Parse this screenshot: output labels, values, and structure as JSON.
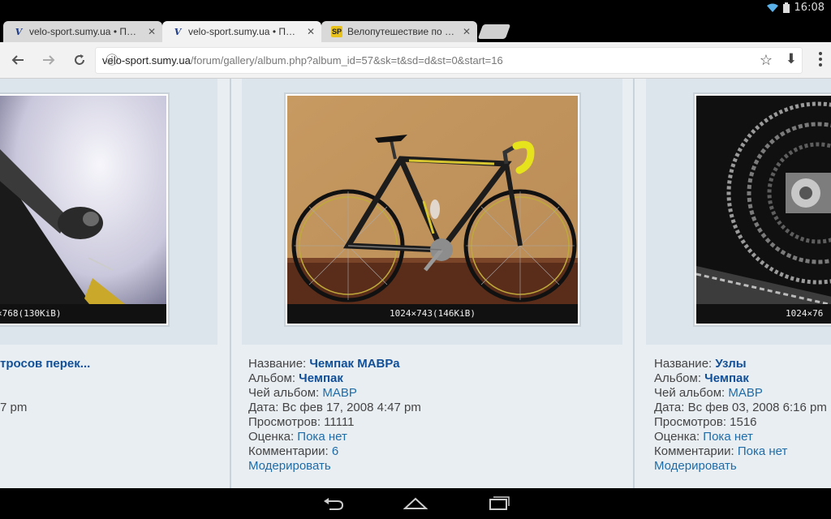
{
  "status_bar": {
    "time": "16:08",
    "icons": [
      "wifi-icon",
      "battery-icon"
    ]
  },
  "tabs": [
    {
      "favicon": "V",
      "title": "velo-sport.sumy.ua • Просмо",
      "active": false
    },
    {
      "favicon": "V",
      "title": "velo-sport.sumy.ua • Просмо",
      "active": true
    },
    {
      "favicon": "SP",
      "title": "Велопутешествие по Одесс",
      "active": false
    }
  ],
  "toolbar": {
    "url_host": "velo-sport.sumy.ua",
    "url_path": "/forum/gallery/album.php?album_id=57&sk=t&sd=d&st=0&start=16"
  },
  "gallery": {
    "items": [
      {
        "caption": "×768(130KiB)",
        "name_label": "",
        "name": "тросов перек...",
        "date_tail": "7 pm"
      },
      {
        "caption": "1024×743(146KiB)",
        "name_label": "Название:",
        "name": "Чемпак МАВРа",
        "album_label": "Альбом:",
        "album": "Чемпак",
        "owner_label": "Чей альбом:",
        "owner": "МАВР",
        "date_label": "Дата:",
        "date": "Вс фев 17, 2008 4:47 pm",
        "views_label": "Просмотров:",
        "views": "11111",
        "rating_label": "Оценка:",
        "rating": "Пока нет",
        "comments_label": "Комментарии:",
        "comments": "6",
        "moderate": "Модерировать"
      },
      {
        "caption": "1024×76",
        "name_label": "Название:",
        "name": "Узлы",
        "album_label": "Альбом:",
        "album": "Чемпак",
        "owner_label": "Чей альбом:",
        "owner": "МАВР",
        "date_label": "Дата:",
        "date": "Вс фев 03, 2008 6:16 pm",
        "views_label": "Просмотров:",
        "views": "1516",
        "rating_label": "Оценка:",
        "rating": "Пока нет",
        "comments_label": "Комментарии:",
        "comments": "Пока нет",
        "moderate": "Модерировать"
      }
    ]
  },
  "nav_buttons": [
    "back-icon",
    "home-icon",
    "recents-icon"
  ]
}
